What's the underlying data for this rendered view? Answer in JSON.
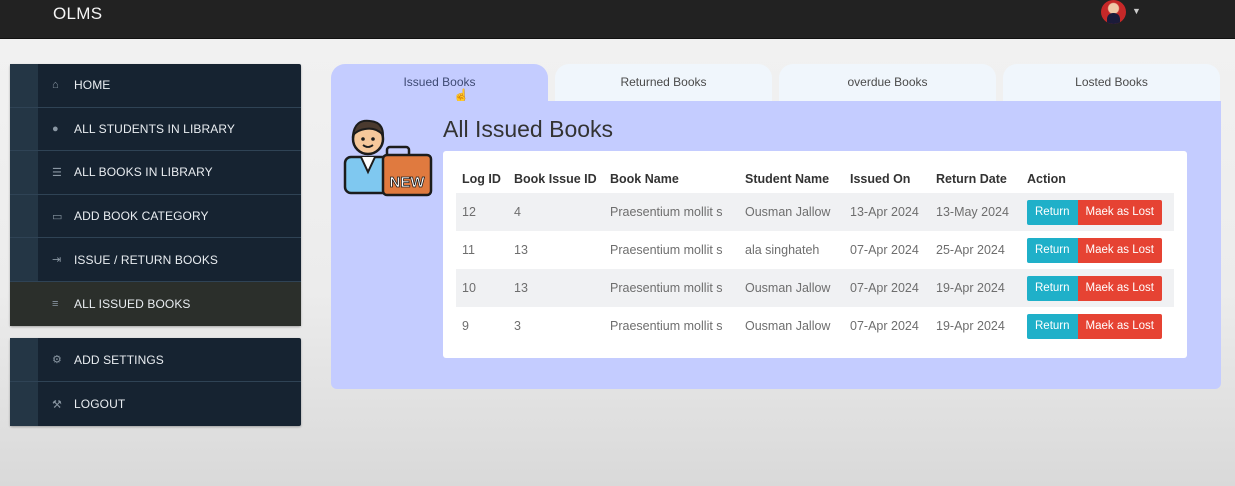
{
  "app": {
    "brand": "OLMS"
  },
  "sidebar": {
    "main": [
      {
        "label": "HOME",
        "icon": "home-icon",
        "glyph": "⌂"
      },
      {
        "label": "ALL STUDENTS IN LIBRARY",
        "icon": "user-icon",
        "glyph": "●"
      },
      {
        "label": "ALL BOOKS IN LIBRARY",
        "icon": "table-icon",
        "glyph": "☰"
      },
      {
        "label": "ADD BOOK CATEGORY",
        "icon": "folder-open-icon",
        "glyph": "▭"
      },
      {
        "label": "ISSUE / RETURN BOOKS",
        "icon": "sign-out-icon",
        "glyph": "⇥"
      },
      {
        "label": "ALL ISSUED BOOKS",
        "icon": "list-icon",
        "glyph": "≡"
      }
    ],
    "secondary": [
      {
        "label": "ADD SETTINGS",
        "icon": "gear-icon",
        "glyph": "⚙"
      },
      {
        "label": "LOGOUT",
        "icon": "wrench-icon",
        "glyph": "⚒"
      }
    ]
  },
  "tabs": [
    "Issued Books",
    "Returned Books",
    "overdue Books",
    "Losted Books"
  ],
  "page": {
    "title": "All Issued Books"
  },
  "table": {
    "headers": [
      "Log ID",
      "Book Issue ID",
      "Book Name",
      "Student Name",
      "Issued On",
      "Return Date",
      "Action"
    ],
    "rows": [
      [
        "12",
        "4",
        "Praesentium mollit s",
        "Ousman Jallow",
        "13-Apr 2024",
        "13-May 2024"
      ],
      [
        "11",
        "13",
        "Praesentium mollit s",
        "ala singhateh",
        "07-Apr 2024",
        "25-Apr 2024"
      ],
      [
        "10",
        "13",
        "Praesentium mollit s",
        "Ousman Jallow",
        "07-Apr 2024",
        "19-Apr 2024"
      ],
      [
        "9",
        "3",
        "Praesentium mollit s",
        "Ousman Jallow",
        "07-Apr 2024",
        "19-Apr 2024"
      ]
    ],
    "return_label": "Return",
    "lost_label": "Maek as Lost"
  },
  "colors": {
    "navbar": "#222222",
    "sidebar": "#162331",
    "panel": "#c4ccff",
    "return": "#1fb0c9",
    "lost": "#e64333"
  }
}
